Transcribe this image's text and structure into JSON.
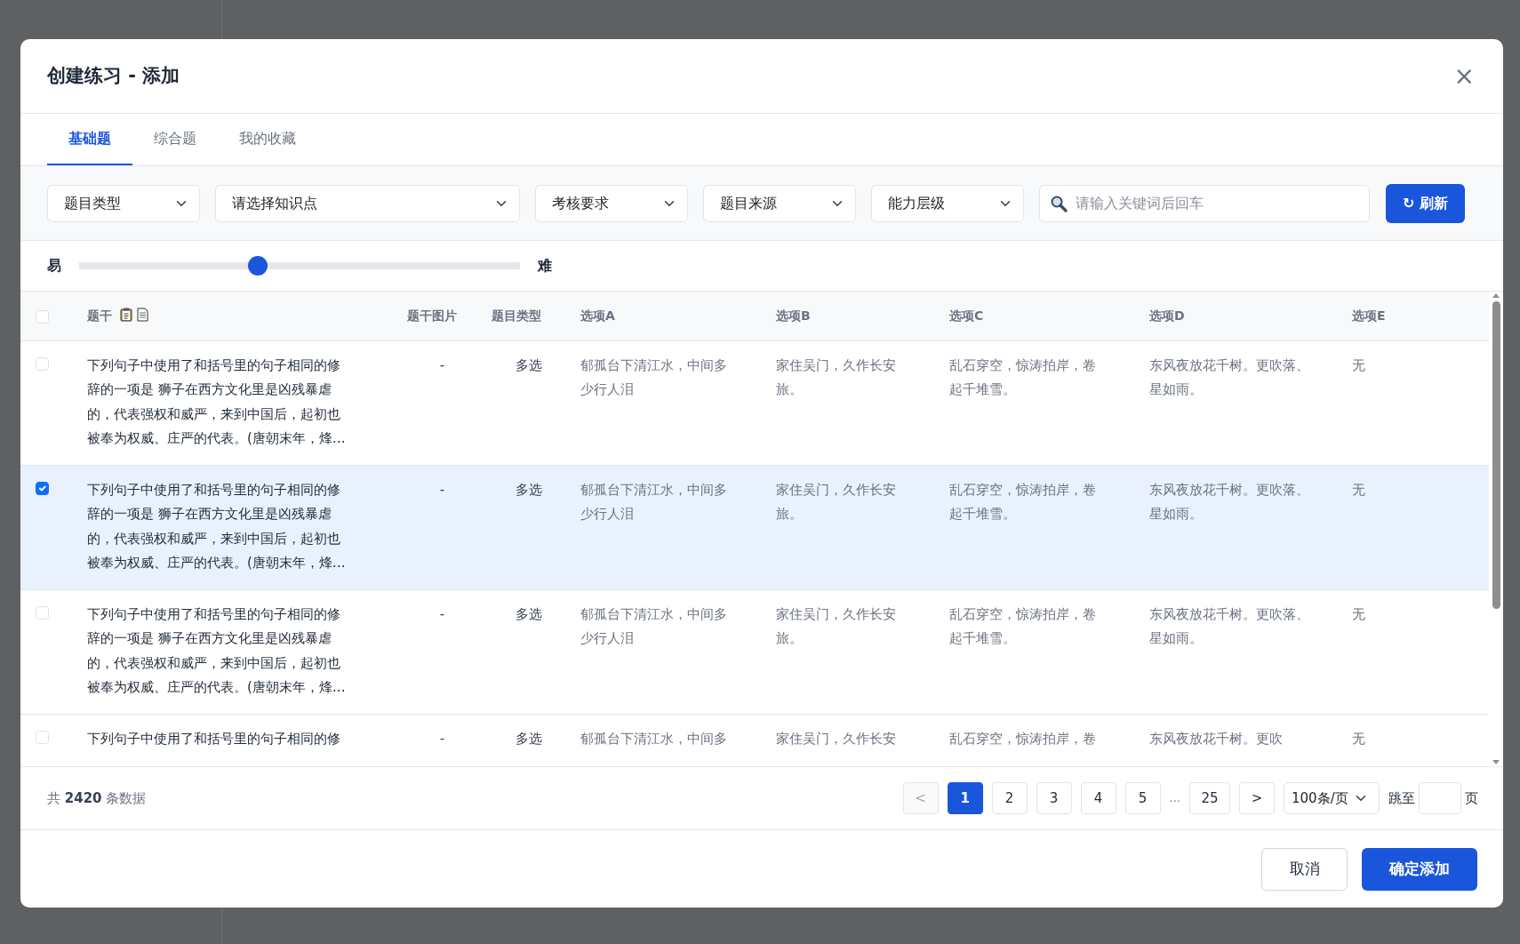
{
  "dialog": {
    "title": "创建练习 - 添加",
    "close": "×"
  },
  "tabs": [
    {
      "label": "基础题",
      "selected": true
    },
    {
      "label": "综合题",
      "selected": false
    },
    {
      "label": "我的收藏",
      "selected": false
    }
  ],
  "filters": [
    {
      "value": "题目类型"
    },
    {
      "value": "请选择知识点"
    },
    {
      "value": "考核要求"
    },
    {
      "value": "题目来源"
    },
    {
      "value": "能力层级"
    }
  ],
  "search": {
    "placeholder": "请输入关键词后回车"
  },
  "refresh_button": {
    "icon": "↻",
    "label": "刷新"
  },
  "difficulty": {
    "min_label": "易",
    "max_label": "难",
    "level": 0.4
  },
  "table": {
    "all_checked": false,
    "columns": [
      "题干",
      "题干图片",
      "题目类型",
      "选项A",
      "选项B",
      "选项C",
      "选项D",
      "选项E"
    ],
    "rows": [
      {
        "checked": false,
        "cells": [
          "下列句子中使用了和括号里的句子相同的修辞的一项是 狮子在西方文化里是凶残暴虐的，代表强权和威严，来到中国后，起初也被奉为权威、庄严的代表。(唐朝末年，烽…",
          "-",
          "多选",
          "郁孤台下清江水，中间多少行人泪",
          "家住吴门，久作长安旅。",
          "乱石穿空，惊涛拍岸，卷起千堆雪。",
          "东风夜放花千树。更吹落、星如雨。",
          "无"
        ]
      },
      {
        "checked": true,
        "cells": [
          "下列句子中使用了和括号里的句子相同的修辞的一项是 狮子在西方文化里是凶残暴虐的，代表强权和威严，来到中国后，起初也被奉为权威、庄严的代表。(唐朝末年，烽…",
          "-",
          "多选",
          "郁孤台下清江水，中间多少行人泪",
          "家住吴门，久作长安旅。",
          "乱石穿空，惊涛拍岸，卷起千堆雪。",
          "东风夜放花千树。更吹落、星如雨。",
          "无"
        ]
      },
      {
        "checked": false,
        "cells": [
          "下列句子中使用了和括号里的句子相同的修辞的一项是 狮子在西方文化里是凶残暴虐的，代表强权和威严，来到中国后，起初也被奉为权威、庄严的代表。(唐朝末年，烽…",
          "-",
          "多选",
          "郁孤台下清江水，中间多少行人泪",
          "家住吴门，久作长安旅。",
          "乱石穿空，惊涛拍岸，卷起千堆雪。",
          "东风夜放花千树。更吹落、星如雨。",
          "无"
        ]
      },
      {
        "checked": false,
        "cells": [
          "下列句子中使用了和括号里的句子相同的修",
          "-",
          "多选",
          "郁孤台下清江水，中间多",
          "家住吴门，久作长安",
          "乱石穿空，惊涛拍岸，卷",
          "东风夜放花千树。更吹",
          "无"
        ]
      }
    ]
  },
  "pagination": {
    "total": "共 **2420** 条数据",
    "prev": "<",
    "pages": [
      {
        "label": "1",
        "selected": true
      },
      {
        "label": "2",
        "selected": false
      },
      {
        "label": "3",
        "selected": false
      },
      {
        "label": "4",
        "selected": false
      },
      {
        "label": "5",
        "selected": false
      }
    ],
    "ellipsis": "...",
    "last": {
      "label": "25",
      "selected": false
    },
    "next": ">",
    "prev_disabled": true,
    "page_size": "100条/页",
    "jump_label": "跳至",
    "page_unit": "页"
  },
  "footer_buttons": [
    {
      "label": "取消",
      "kind": "secondary"
    },
    {
      "label": "确定添加",
      "kind": "primary"
    }
  ]
}
